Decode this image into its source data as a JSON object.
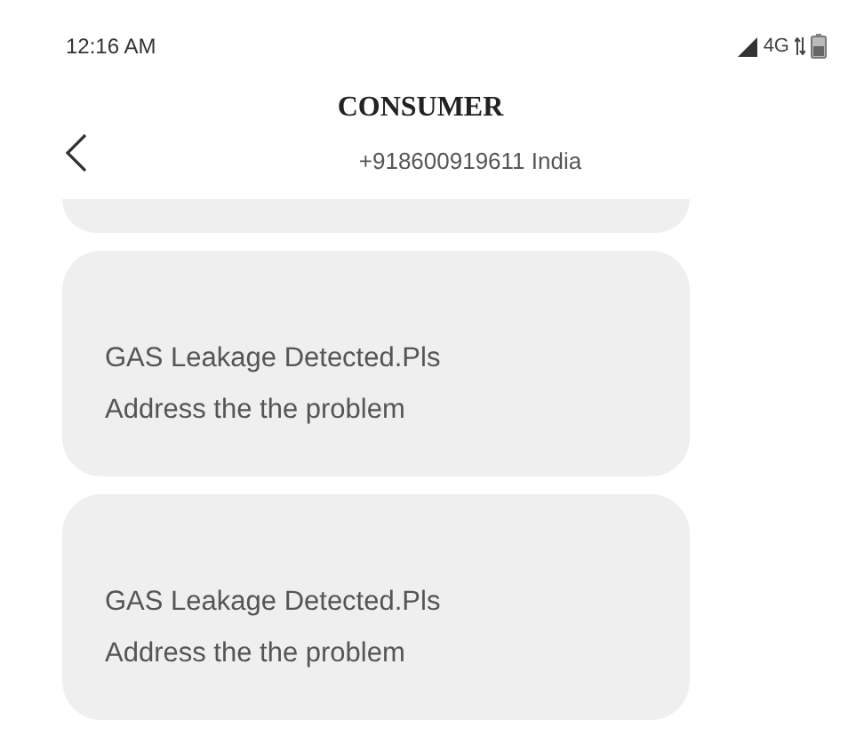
{
  "status_bar": {
    "time": "12:16 AM",
    "network": "4G"
  },
  "header": {
    "title": "CONSUMER",
    "subtitle": "+918600919611 India"
  },
  "messages": [
    {
      "kind": "partial"
    },
    {
      "kind": "text",
      "text": "GAS Leakage Detected.Pls\nAddress the the problem"
    },
    {
      "kind": "text",
      "text": "GAS Leakage Detected.Pls\nAddress the the problem"
    }
  ]
}
